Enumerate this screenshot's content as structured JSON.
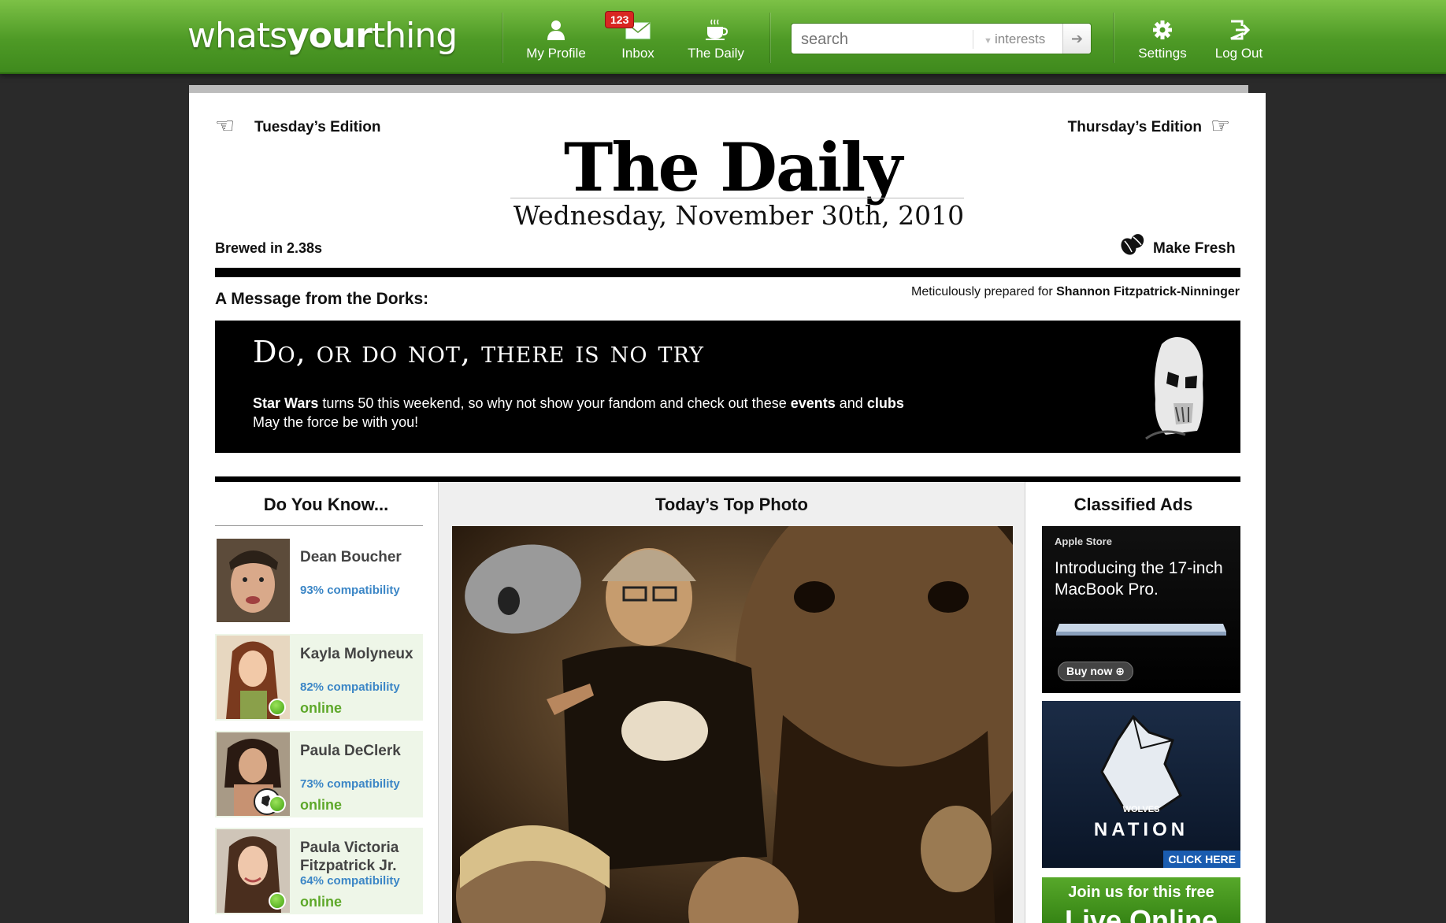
{
  "nav": {
    "logo_light_1": "whats",
    "logo_bold": "your",
    "logo_light_2": "thing",
    "my_profile": "My Profile",
    "inbox": "Inbox",
    "inbox_badge": "123",
    "the_daily": "The Daily",
    "search_placeholder": "search",
    "search_scope": "interests",
    "settings": "Settings",
    "log_out": "Log Out"
  },
  "paper": {
    "prev_edition": "Tuesday’s Edition",
    "next_edition": "Thursday’s Edition",
    "title": "The Daily",
    "date": "Wednesday, November 30th, 2010",
    "brewed": "Brewed in 2.38s",
    "make_fresh": "Make Fresh"
  },
  "message": {
    "heading": "A Message from the Dorks:",
    "prepared_prefix": "Meticulously prepared for",
    "prepared_name": "Shannon Fitzpatrick-Ninninger",
    "banner_title": "Do, or do not, there is no try",
    "line1_bold_a": "Star Wars",
    "line1_mid": " turns 50 this weekend, so why not show your fandom and check out these ",
    "line1_bold_b": "events",
    "line1_and": " and ",
    "line1_bold_c": "clubs",
    "line2": "May the force be with you!"
  },
  "do_you_know": {
    "heading": "Do You Know...",
    "people": [
      {
        "name": "Dean Boucher",
        "compat": "93% compatibility",
        "status": ""
      },
      {
        "name": "Kayla Molyneux",
        "compat": "82% compatibility",
        "status": "online"
      },
      {
        "name": "Paula DeClerk",
        "compat": "73% compatibility",
        "status": "online"
      },
      {
        "name": "Paula Victoria Fitzpatrick Jr.",
        "compat": "64% compatibility",
        "status": "online"
      }
    ]
  },
  "top_photo": {
    "heading": "Today’s Top Photo"
  },
  "classifieds": {
    "heading": "Classified Ads",
    "ad1_brand": "Apple Store",
    "ad1_text": "Introducing the 17-inch MacBook Pro.",
    "ad1_button": "Buy now",
    "ad2_text": "NATION",
    "ad2_sub": "WOLVES",
    "ad2_button": "CLICK HERE",
    "ad3_text": "Join us for this free",
    "ad3_big": "Live Online"
  },
  "colors": {
    "nav_green": "#4e9a26",
    "compat_blue": "#3b86c6",
    "online_green": "#5ea82a"
  }
}
